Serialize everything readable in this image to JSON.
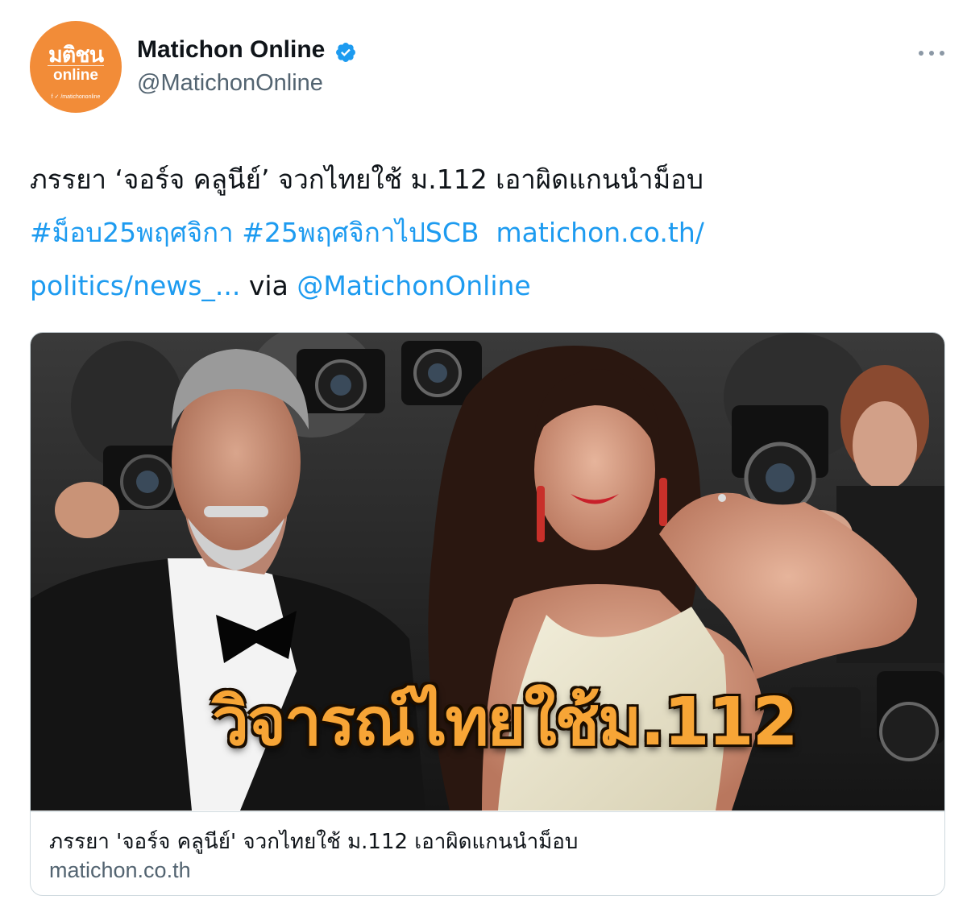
{
  "author": {
    "display_name": "Matichon Online",
    "handle": "@MatichonOnline",
    "verified": true,
    "avatar": {
      "logo_text": "มติชน",
      "logo_sub": "online",
      "social_text": "f ✓ /matichononline"
    }
  },
  "more_icon": "more-horizontal-icon",
  "tweet": {
    "line1": "ภรรยา ‘จอร์จ คลูนีย์’ จวกไทยใช้ ม.112 เอาผิดแกนนำม็อบ",
    "hashtag1": "#ม็อบ25พฤศจิกา",
    "hashtag2": "#25พฤศจิกาไปSCB",
    "link_part1": "matichon.co.th/",
    "link_part2": "politics/news_...",
    "via": "via",
    "mention": "@MatichonOnline"
  },
  "card": {
    "image_overlay_text": "วิจารณ์ไทยใช้ม.112",
    "title": "ภรรยา 'จอร์จ คลูนีย์' จวกไทยใช้ ม.112 เอาผิดแกนนำม็อบ",
    "domain": "matichon.co.th"
  },
  "colors": {
    "link": "#1d9bf0",
    "avatar_bg": "#f28c38",
    "overlay_text": "#f7a536",
    "secondary_text": "#536471"
  }
}
